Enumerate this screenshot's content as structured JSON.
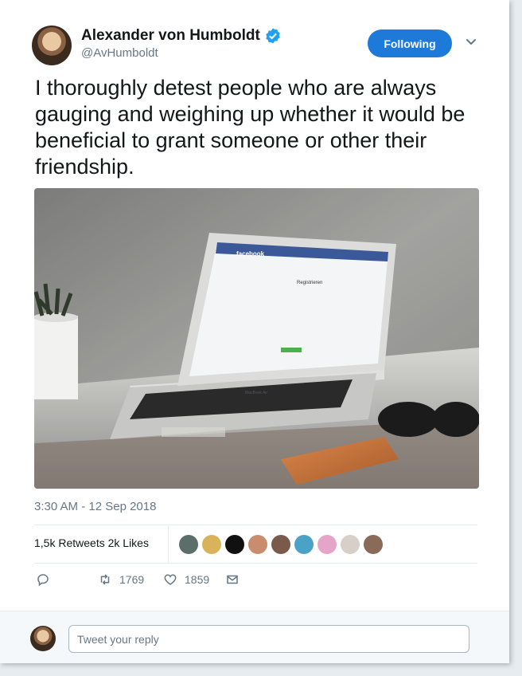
{
  "author": {
    "name": "Alexander von Humboldt",
    "handle": "@AvHumboldt",
    "verified": true
  },
  "follow_button_label": "Following",
  "tweet": {
    "text": "I thoroughly detest people who are always gauging and weighing up whether it would be beneficial to grant someone or other their friendship.",
    "timestamp": "3:30 AM - 12 Sep 2018"
  },
  "photo": {
    "screen_brand": "facebook",
    "screen_heading": "Registrieren",
    "laptop_label": "MacBook Air"
  },
  "stats": {
    "retweets_label": "1,5k Retweets",
    "likes_label": "2k Likes",
    "liker_colors": [
      "#5b6e6a",
      "#d9b35a",
      "#111111",
      "#c98c6e",
      "#7a5a4a",
      "#4aa3c7",
      "#e5a5c8",
      "#d8d0c8",
      "#8a6a58"
    ]
  },
  "actions": {
    "reply_count": "",
    "retweet_count": "1769",
    "like_count": "1859"
  },
  "reply": {
    "placeholder": "Tweet your reply"
  },
  "colors": {
    "accent": "#1d7ad9",
    "muted": "#657786"
  }
}
